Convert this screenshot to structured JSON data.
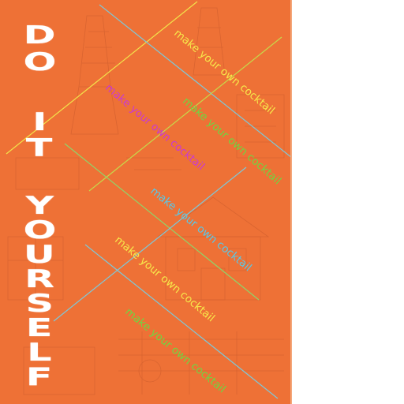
{
  "poster": {
    "background_color": "#ee7136",
    "title_words": [
      {
        "word": "DO",
        "letters": [
          "D",
          "O"
        ]
      },
      {
        "word": "IT",
        "letters": [
          "I",
          "T"
        ]
      },
      {
        "word": "YOURSELF",
        "letters": [
          "Y",
          "O",
          "U",
          "R",
          "S",
          "E",
          "L",
          "F"
        ]
      }
    ],
    "title_color": "#ffffff",
    "phrases": [
      {
        "text": "make your own cocktail",
        "color": "#f7e84a"
      },
      {
        "text": "make your own cocktail",
        "color": "#c93bd0"
      },
      {
        "text": "make your own cocktail",
        "color": "#6fd642"
      },
      {
        "text": "make your own cocktail",
        "color": "#58c8e8"
      },
      {
        "text": "make your own cocktail",
        "color": "#f7e84a"
      },
      {
        "text": "make your own cocktail",
        "color": "#6fd642"
      }
    ],
    "line_colors": [
      "#f2e34a",
      "#7ec8d8",
      "#c6d94a",
      "#8fd46a",
      "#7ec8d8",
      "#7ec8d8"
    ]
  }
}
